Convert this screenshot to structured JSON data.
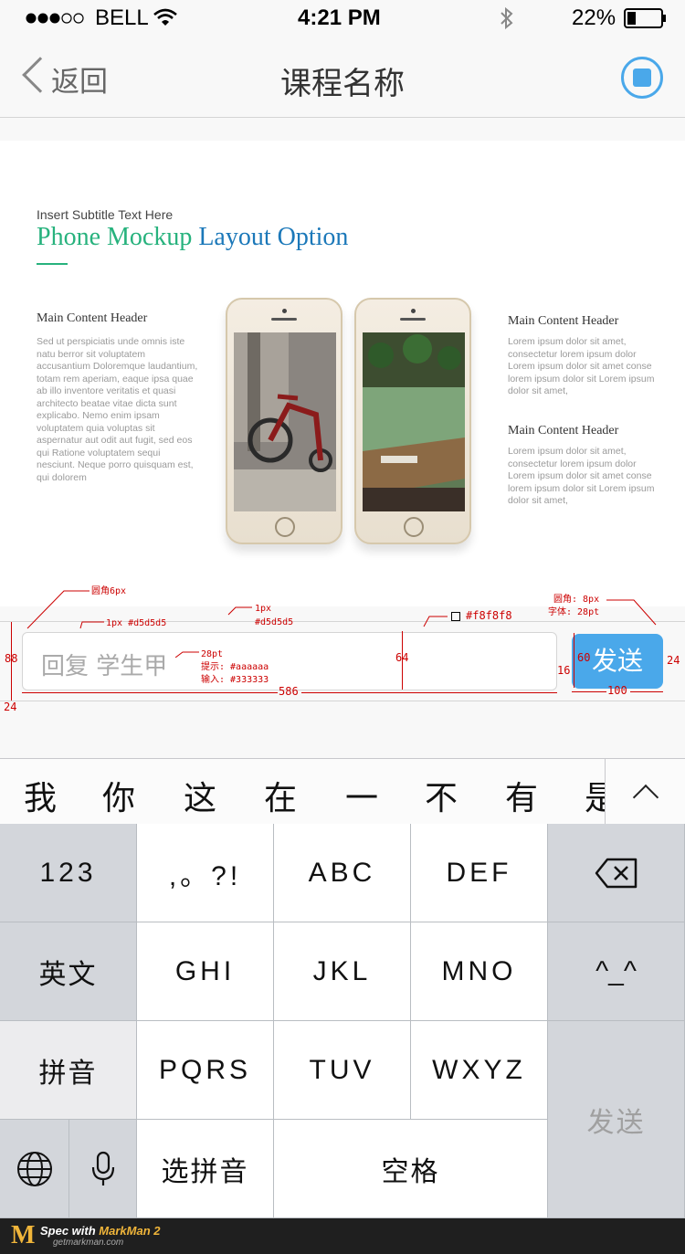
{
  "status": {
    "carrier": "BELL",
    "time": "4:21 PM",
    "battery": "22%"
  },
  "nav": {
    "back_label": "返回",
    "title": "课程名称"
  },
  "slide": {
    "subtitle": "Insert Subtitle Text Here",
    "title_part1": "Phone Mockup",
    "title_part2": "Layout Option",
    "left": {
      "header": "Main Content Header",
      "body": "Sed ut perspiciatis unde omnis iste natu berror sit voluptatem accusantium Doloremque laudantium, totam rem aperiam, eaque ipsa quae ab illo inventore veritatis et quasi architecto beatae vitae dicta sunt explicabo. Nemo enim ipsam voluptatem quia voluptas sit aspernatur aut odit aut fugit, sed eos qui Ratione voluptatem sequi nesciunt. Neque porro quisquam est, qui dolorem"
    },
    "right": [
      {
        "header": "Main Content Header",
        "body": "Lorem ipsum dolor sit amet, consectetur lorem ipsum dolor Lorem ipsum dolor sit amet conse lorem ipsum dolor sit Lorem ipsum dolor sit amet,"
      },
      {
        "header": "Main Content Header",
        "body": "Lorem ipsum dolor sit amet, consectetur lorem ipsum dolor Lorem ipsum dolor sit amet conse lorem ipsum dolor sit Lorem ipsum dolor sit amet,"
      }
    ]
  },
  "input_bar": {
    "placeholder": "回复 学生甲",
    "send_label": "发送"
  },
  "spec": {
    "radius6": "圆角6px",
    "border_left": "1px #d5d5d5",
    "border_top": "1px",
    "border_top_color": "#d5d5d5",
    "bg_color": "#f8f8f8",
    "radius8": "圆角: 8px",
    "font28": "字体: 28pt",
    "font_size": "28pt",
    "hint": "提示: #aaaaaa",
    "input": "输入: #333333",
    "h88": "88",
    "h64": "64",
    "h60": "60",
    "gap16": "16",
    "m24": "24",
    "w586": "586",
    "w100": "100"
  },
  "candidates": [
    "我",
    "你",
    "这",
    "在",
    "一",
    "不",
    "有",
    "是"
  ],
  "keyboard": {
    "k123": "123",
    "punct": ",。?!",
    "abc": "ABC",
    "def": "DEF",
    "english": "英文",
    "ghi": "GHI",
    "jkl": "JKL",
    "mno": "MNO",
    "emoji": "^_^",
    "pinyin": "拼音",
    "pqrs": "PQRS",
    "tuv": "TUV",
    "wxyz": "WXYZ",
    "send": "发送",
    "select_pinyin": "选拼音",
    "space": "空格"
  },
  "footer": {
    "brand_prefix": "Spec with ",
    "brand": "MarkMan 2",
    "url": "getmarkman.com"
  },
  "colors": {
    "accent": "#4aa8ea",
    "placeholder": "#aaaaaa",
    "border": "#d5d5d5",
    "bar_bg": "#f8f8f8",
    "spec_red": "#cc0000"
  }
}
